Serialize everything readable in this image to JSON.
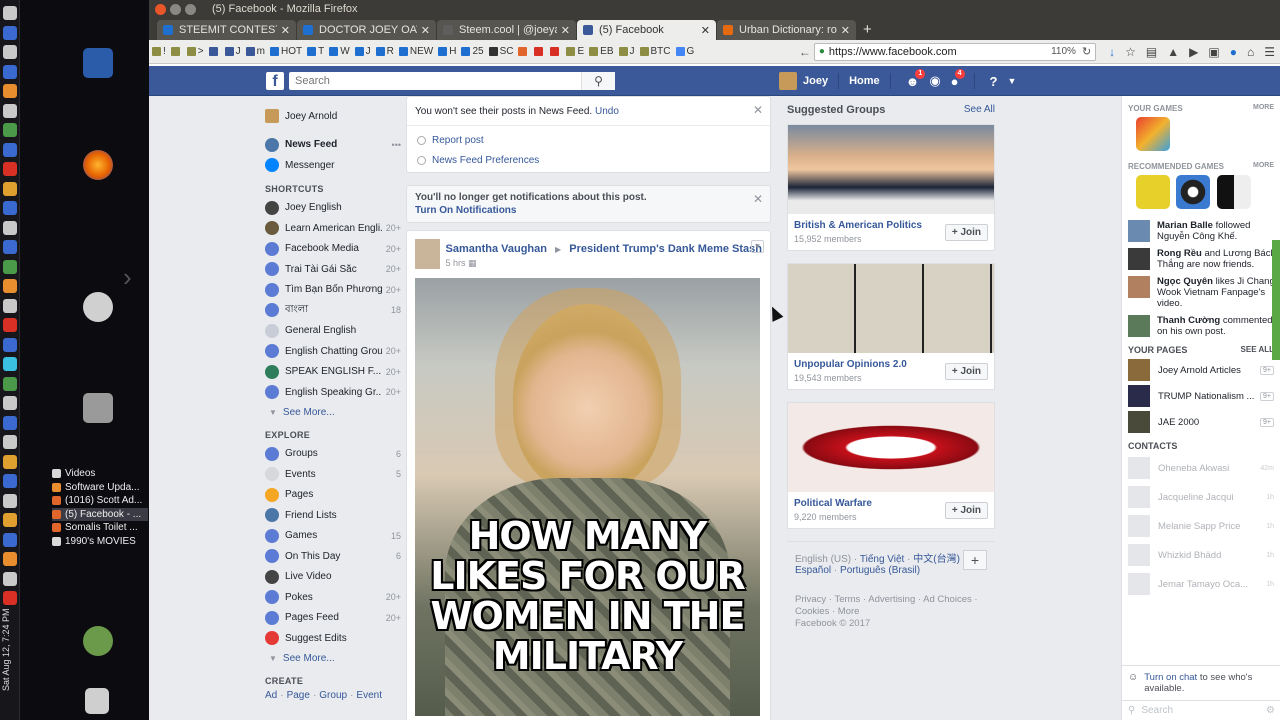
{
  "desktop": {
    "clock": "Sat Aug 12, 7:24 PM",
    "taskbar": [
      {
        "label": "Videos",
        "color": "#d9d9d9"
      },
      {
        "label": "Software Upda...",
        "color": "#e88e2e"
      },
      {
        "label": "(1016) Scott Ad...",
        "color": "#e0662b"
      },
      {
        "label": "(5) Facebook - ...",
        "color": "#e0662b",
        "active": true
      },
      {
        "label": "Somalis Toilet ...",
        "color": "#e0662b"
      },
      {
        "label": "1990's MOVIES",
        "color": "#d9d9d9"
      }
    ],
    "lang": "en"
  },
  "browser": {
    "title": "(5) Facebook - Mozilla Firefox",
    "tabs": [
      {
        "label": "STEEMIT CONTEST UP",
        "color": "#1f6fd0"
      },
      {
        "label": "DOCTOR JOEY OATMI",
        "color": "#1f6fd0"
      },
      {
        "label": "Steem.cool | @joeyarnold",
        "color": "#5e5e5e"
      },
      {
        "label": "(5) Facebook",
        "color": "#3b5998",
        "active": true
      },
      {
        "label": "Urban Dictionary: rool",
        "color": "#e86a10"
      }
    ],
    "bookmarks": [
      {
        "label": "!",
        "color": "#8d8d44"
      },
      {
        "label": "",
        "color": "#8d8d44"
      },
      {
        "label": ">",
        "color": "#8d8d44"
      },
      {
        "label": "",
        "color": "#3b5998"
      },
      {
        "label": "J",
        "color": "#3b5998"
      },
      {
        "label": "m",
        "color": "#3b5998"
      },
      {
        "label": "HOT",
        "color": "#1f6fd0"
      },
      {
        "label": "T",
        "color": "#1f6fd0"
      },
      {
        "label": "W",
        "color": "#1f6fd0"
      },
      {
        "label": "J",
        "color": "#1f6fd0"
      },
      {
        "label": "R",
        "color": "#1f6fd0"
      },
      {
        "label": "NEW",
        "color": "#1f6fd0"
      },
      {
        "label": "H",
        "color": "#1f6fd0"
      },
      {
        "label": "25",
        "color": "#1f6fd0"
      },
      {
        "label": "SC",
        "color": "#333333"
      },
      {
        "label": "",
        "color": "#e0662b"
      },
      {
        "label": "",
        "color": "#d93025"
      },
      {
        "label": "",
        "color": "#d93025"
      },
      {
        "label": "E",
        "color": "#8d8d44"
      },
      {
        "label": "EB",
        "color": "#8d8d44"
      },
      {
        "label": "J",
        "color": "#8d8d44"
      },
      {
        "label": "BTC",
        "color": "#8d8d44"
      },
      {
        "label": "G",
        "color": "#4285f4"
      }
    ],
    "url": "https://www.facebook.com",
    "zoom": "110%"
  },
  "fb": {
    "search_placeholder": "Search",
    "user": "Joey",
    "home": "Home",
    "badges": {
      "friends": "1",
      "notifications": "4"
    },
    "left": {
      "profile": "Joey Arnold",
      "main": [
        {
          "label": "News Feed",
          "color": "#4a76a8",
          "bold": true
        },
        {
          "label": "Messenger",
          "color": "#0084ff"
        }
      ],
      "shortcuts_title": "SHORTCUTS",
      "shortcuts": [
        {
          "label": "Joey English",
          "count": "",
          "color": "#444444"
        },
        {
          "label": "Learn American Engli...",
          "count": "20+",
          "color": "#6a5a3e"
        },
        {
          "label": "Facebook Media",
          "count": "20+",
          "color": "#5b7bd5"
        },
        {
          "label": "Trai Tài Gái Sắc",
          "count": "20+",
          "color": "#5b7bd5"
        },
        {
          "label": "Tìm Bạn Bốn Phương",
          "count": "20+",
          "color": "#5b7bd5"
        },
        {
          "label": "বাংলা",
          "count": "18",
          "color": "#5b7bd5"
        },
        {
          "label": "General English",
          "count": "",
          "color": "#c8cdd8"
        },
        {
          "label": "English Chatting Group",
          "count": "20+",
          "color": "#5b7bd5"
        },
        {
          "label": "SPEAK ENGLISH F...",
          "count": "20+",
          "color": "#2e7d5b"
        },
        {
          "label": "English Speaking Gr...",
          "count": "20+",
          "color": "#5b7bd5"
        }
      ],
      "see_more": "See More...",
      "explore_title": "EXPLORE",
      "explore": [
        {
          "label": "Groups",
          "count": "6",
          "color": "#5b7bd5"
        },
        {
          "label": "Events",
          "count": "5",
          "color": "#d6d8dc"
        },
        {
          "label": "Pages",
          "count": "",
          "color": "#f5a623"
        },
        {
          "label": "Friend Lists",
          "count": "",
          "color": "#4a76a8"
        },
        {
          "label": "Games",
          "count": "15",
          "color": "#5b7bd5"
        },
        {
          "label": "On This Day",
          "count": "6",
          "color": "#5b7bd5"
        },
        {
          "label": "Live Video",
          "count": "",
          "color": "#444444"
        },
        {
          "label": "Pokes",
          "count": "20+",
          "color": "#5b7bd5"
        },
        {
          "label": "Pages Feed",
          "count": "20+",
          "color": "#5b7bd5"
        },
        {
          "label": "Suggest Edits",
          "count": "",
          "color": "#e53935"
        }
      ],
      "see_more2": "See More...",
      "create_title": "CREATE",
      "create": [
        "Ad",
        "Page",
        "Group",
        "Event"
      ]
    },
    "feed": {
      "hidden_msg": "You won't see their posts in News Feed.",
      "undo": "Undo",
      "report": "Report post",
      "prefs": "News Feed Preferences",
      "notif_msg": "You'll no longer get notifications about this post.",
      "notif_link": "Turn On Notifications",
      "post": {
        "author": "Samantha Vaughan",
        "group": "President Trump's Dank Meme Stash",
        "time": "5 hrs",
        "image_text": [
          "HOW MANY",
          "LIKES FOR OUR",
          "WOMEN IN THE",
          "MILITARY"
        ]
      }
    },
    "suggested": {
      "title": "Suggested Groups",
      "see_all": "See All",
      "join": "Join",
      "groups": [
        {
          "name": "British & American Politics",
          "members": "15,952 members"
        },
        {
          "name": "Unpopular Opinions 2.0",
          "members": "19,543 members"
        },
        {
          "name": "Political Warfare",
          "members": "9,220 members"
        }
      ]
    },
    "languages": {
      "current": "English (US)",
      "links": [
        "Tiếng Việt",
        "中文(台灣)",
        "Español",
        "Português (Brasil)"
      ]
    },
    "footer": {
      "links": [
        "Privacy",
        "Terms",
        "Advertising",
        "Ad Choices",
        "Cookies",
        "More"
      ],
      "copyright": "Facebook © 2017"
    },
    "sidebar": {
      "your_games": "YOUR GAMES",
      "more": "MORE",
      "recommended": "RECOMMENDED GAMES",
      "ticker": [
        {
          "name": "Marian Balle",
          "text": "followed Nguyễn Công Khế."
        },
        {
          "name": "Rong Rều",
          "text": "and Lương Bách Thắng are now friends."
        },
        {
          "name": "Ngọc Quyên",
          "text": "likes Ji Chang Wook Vietnam Fanpage's video."
        },
        {
          "name": "Thanh Cường",
          "text": "commented on his own post."
        }
      ],
      "pages_title": "YOUR PAGES",
      "see_all": "SEE ALL",
      "pages": [
        {
          "label": "Joey Arnold Articles",
          "count": "9+"
        },
        {
          "label": "TRUMP Nationalism ...",
          "count": "9+"
        },
        {
          "label": "JAE 2000",
          "count": "9+"
        }
      ],
      "contacts_title": "CONTACTS",
      "contacts": [
        {
          "label": "Oheneba Akwasi",
          "time": "42m"
        },
        {
          "label": "Jacqueline Jacqui",
          "time": "1h"
        },
        {
          "label": "Melanie Sapp Price",
          "time": "1h"
        },
        {
          "label": "Whizkid Bhädd",
          "time": "1h"
        },
        {
          "label": "Jemar Tamayo Oca...",
          "time": "1h"
        }
      ],
      "chat_link": "Turn on chat",
      "chat_text": "to see who's available.",
      "search": "Search"
    }
  }
}
